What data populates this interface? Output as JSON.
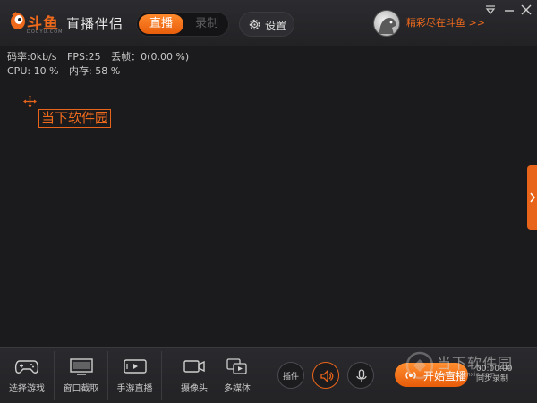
{
  "header": {
    "brand_text": "斗鱼",
    "brand_sub": "DOUYU.COM",
    "app_title": "直播伴侣",
    "mode_live": "直播",
    "mode_record": "录制",
    "settings_label": "设置",
    "user_link": "精彩尽在斗鱼 >>"
  },
  "stats": {
    "bitrate": "码率:0kb/s",
    "fps": "FPS:25",
    "dropped": "丢帧：0(0.00 %)",
    "cpu": "CPU: 10 %",
    "memory": "内存: 58 %"
  },
  "preview": {
    "text_source": "当下软件园"
  },
  "toolbar": {
    "items": [
      {
        "label": "选择游戏",
        "icon": "gamepad-icon"
      },
      {
        "label": "窗口截取",
        "icon": "monitor-icon"
      },
      {
        "label": "手游直播",
        "icon": "phone-landscape-icon"
      },
      {
        "label": "摄像头",
        "icon": "camera-icon"
      },
      {
        "label": "多媒体",
        "icon": "media-icon"
      }
    ],
    "plugin_label": "插件",
    "start_label": "开始直播",
    "timer": "00:00:00",
    "record_hint": "同步录制"
  },
  "watermark": {
    "text": "当下软件园",
    "url": "www.downxia.com"
  },
  "colors": {
    "accent": "#f06a1c",
    "background": "#1b1b1d",
    "toolbar": "#2a2a2e"
  }
}
